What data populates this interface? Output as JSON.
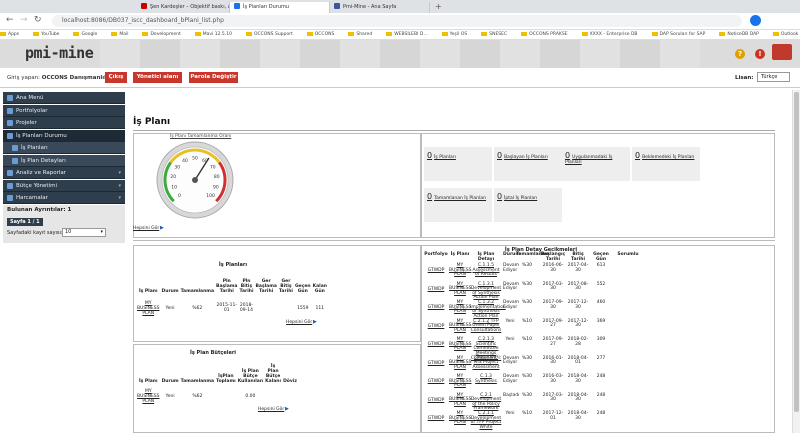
{
  "browser": {
    "tabs": [
      {
        "label": "Şen Kardeşler – Objektif baskı, atı...",
        "color": "#cc0000"
      },
      {
        "label": "İş Planları Durumu",
        "color": "#1a73e8"
      },
      {
        "label": "Pmi-Mine - Ana Sayfa",
        "color": "#3b5998"
      }
    ],
    "url": "localhost:8086/DB037_iscc_dashboard_bPlani_list.php",
    "bookmarks": [
      "Apps",
      "YouTube",
      "Google",
      "Mail",
      "Development",
      "Mavi 12.5.10",
      "OCCONS Support",
      "OCCONS",
      "Shared",
      "WEBSILEBI D...",
      "Yeşil OS",
      "SNESEC",
      "OCCONS PRAKSE",
      "XXXX - Enterprise DB",
      "DAP Soruları for SAP",
      "NoticeDB DAP",
      "Outlook",
      "Öneri Bölümü"
    ]
  },
  "header": {
    "logo": "pmi-mine",
    "login_label": "Giriş yapan:",
    "user": "OCCONS Danışmanlık",
    "buttons": [
      "Çıkış",
      "Yönetici alanı",
      "Parola Değiştir"
    ],
    "lang_label": "Lisan:",
    "lang_value": "Türkçe"
  },
  "sidebar": {
    "items": [
      {
        "label": "Ana Menü",
        "sub": false
      },
      {
        "label": "Portfolyolar",
        "sub": false
      },
      {
        "label": "Projeler",
        "sub": false
      },
      {
        "label": "İş Planları Durumu",
        "sub": false
      },
      {
        "label": "İş Planları",
        "sub": true
      },
      {
        "label": "İş Plan Detayları",
        "sub": true
      },
      {
        "label": "Analiz ve Raporlar",
        "sub": false
      },
      {
        "label": "Bütçe Yönetimi",
        "sub": false
      },
      {
        "label": "Harcamalar",
        "sub": false
      }
    ],
    "found": "Bulunan Ayrıntılar: 1",
    "page": "Sayfa 1 / 1",
    "per_page_label": "Sayfadaki kayıt sayısı:",
    "per_page_value": "10"
  },
  "main": {
    "title": "İş Planı",
    "gauge": {
      "title": "İş Planı Tamamlanma Oranı",
      "value": 62,
      "ticks": [
        "0",
        "10",
        "20",
        "30",
        "40",
        "50",
        "60",
        "70",
        "80",
        "90",
        "100"
      ],
      "link": "Hepsini Gör"
    },
    "stats": [
      {
        "count": "0",
        "label": "İş Planları"
      },
      {
        "count": "0",
        "label": "Başlayan İş Planları"
      },
      {
        "count": "0",
        "label": "Uygulanmadaki İş Planları"
      },
      {
        "count": "0",
        "label": "Beklemedeki İş Planları"
      },
      {
        "count": "0",
        "label": "Tamamlanan İş Planları"
      },
      {
        "count": "0",
        "label": "İptal İş Planları"
      }
    ],
    "plans": {
      "title": "İş Planları",
      "headers": [
        "İş Planı",
        "Durum",
        "Tamamlanma",
        "Pln Başlama Tarihi",
        "Pln Bitiş Tarihi",
        "Ger Başlama Tarihi",
        "Ger Bitiş Tarihi",
        "Geçen Gün",
        "Kalan Gün"
      ],
      "rows": [
        [
          "MY BUSINESS PLAN",
          "Yeni",
          "%62",
          "2015-11-01",
          "2018-09-14",
          "",
          "",
          "1559",
          "111"
        ]
      ],
      "link": "Hepsini Gör"
    },
    "budget": {
      "title": "İş Plan Bütçeleri",
      "headers": [
        "İş Planı",
        "Durum",
        "Tamamlanma",
        "İşPlan Toplamı",
        "İş Plan Bütçe Kullanılan",
        "İş Plan Bütçe Kalanı",
        "Döviz"
      ],
      "rows": [
        [
          "MY BUSINESS PLAN",
          "Yeni",
          "%62",
          "",
          "0.00",
          "",
          ""
        ]
      ],
      "link": "Hepsini Gör"
    },
    "details": {
      "title": "İş Plan Detay Gecikmeleri",
      "headers": [
        "Portfolyo",
        "İş Planı",
        "İş Plan Detayı",
        "Durum",
        "Tamamlanma",
        "Başlangıç Tarihi",
        "Bitiş Tarihi",
        "Geçen Gün",
        "Sorumlu"
      ],
      "rows": [
        [
          "GTWDP",
          "MY BUSINESS PLAN",
          "C.1.1.5 Assessment of Results",
          "Devam Ediyor",
          "%30",
          "2016-06-30",
          "2017-04-30",
          "613"
        ],
        [
          "GTWDP",
          "MY BUSINESS PLAN",
          "C.1.3.1 Development of Synthesis Action Plan",
          "Devam Ediyor",
          "%30",
          "2017-03-30",
          "2017-08-30",
          "552"
        ],
        [
          "GTWDP",
          "MY BUSINESS PLAN",
          "C.1.3.2 Implementation of Synthesis Action Plan",
          "Devam Ediyor",
          "%30",
          "2017-09-30",
          "2017-12-30",
          "460"
        ],
        [
          "GTWDP",
          "MY BUSINESS PLAN",
          "C.2.1.2 TFP Green Paper Consultations",
          "Yeni",
          "%10",
          "2017-09-27",
          "2017-12-30",
          "369"
        ],
        [
          "GTWDP",
          "MY BUSINESS PLAN",
          "C.2.1.3 Scientific Committee Meetings (Tentative)",
          "Yeni",
          "%10",
          "2017-09-27",
          "2018-02-28",
          "309"
        ],
        [
          "GTWDP",
          "MY BUSINESS PLAN",
          "Component I: MIS Project Assessment",
          "Devam Ediyor",
          "%30",
          "2016-01-30",
          "2018-04-01",
          "277"
        ],
        [
          "GTWDP",
          "MY BUSINESS PLAN",
          "C.1.3 Synthesis",
          "Devam Ediyor",
          "%30",
          "2016-03-30",
          "2018-04-30",
          "248"
        ],
        [
          "GTWDP",
          "MY BUSINESS PLAN",
          "C.2.1 Development of the Policy Framework",
          "Başladı",
          "%30",
          "2017-03-30",
          "2018-04-30",
          "248"
        ],
        [
          "GTWDP",
          "MY BUSINESS PLAN",
          "C.2.1.1 Development of TFP Project White",
          "Yeni",
          "%10",
          "2017-12-01",
          "2018-04-30",
          "248"
        ]
      ]
    }
  },
  "colors": {
    "sidebar": "#2e3e4c",
    "accent_red": "#c9372c"
  }
}
